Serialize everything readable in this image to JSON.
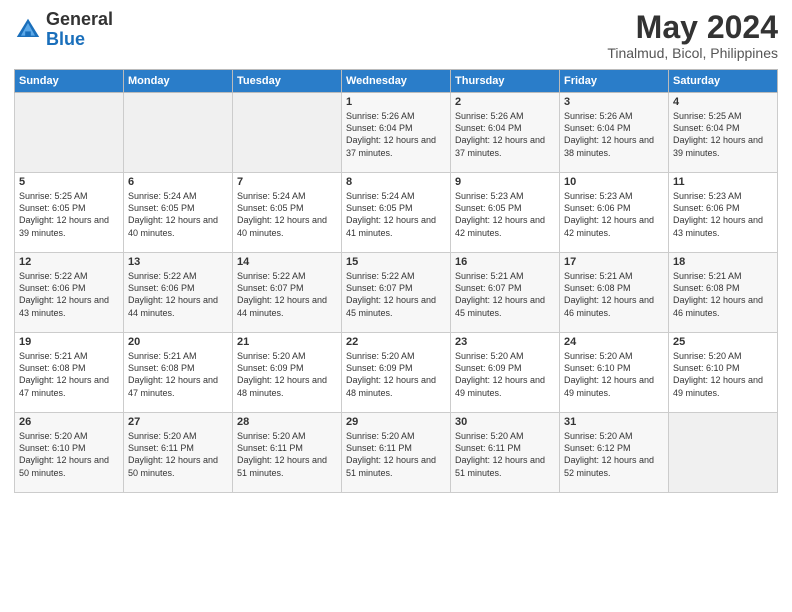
{
  "logo": {
    "general": "General",
    "blue": "Blue"
  },
  "header": {
    "title": "May 2024",
    "subtitle": "Tinalmud, Bicol, Philippines"
  },
  "weekdays": [
    "Sunday",
    "Monday",
    "Tuesday",
    "Wednesday",
    "Thursday",
    "Friday",
    "Saturday"
  ],
  "weeks": [
    [
      {
        "day": "",
        "sunrise": "",
        "sunset": "",
        "daylight": ""
      },
      {
        "day": "",
        "sunrise": "",
        "sunset": "",
        "daylight": ""
      },
      {
        "day": "",
        "sunrise": "",
        "sunset": "",
        "daylight": ""
      },
      {
        "day": "1",
        "sunrise": "Sunrise: 5:26 AM",
        "sunset": "Sunset: 6:04 PM",
        "daylight": "Daylight: 12 hours and 37 minutes."
      },
      {
        "day": "2",
        "sunrise": "Sunrise: 5:26 AM",
        "sunset": "Sunset: 6:04 PM",
        "daylight": "Daylight: 12 hours and 37 minutes."
      },
      {
        "day": "3",
        "sunrise": "Sunrise: 5:26 AM",
        "sunset": "Sunset: 6:04 PM",
        "daylight": "Daylight: 12 hours and 38 minutes."
      },
      {
        "day": "4",
        "sunrise": "Sunrise: 5:25 AM",
        "sunset": "Sunset: 6:04 PM",
        "daylight": "Daylight: 12 hours and 39 minutes."
      }
    ],
    [
      {
        "day": "5",
        "sunrise": "Sunrise: 5:25 AM",
        "sunset": "Sunset: 6:05 PM",
        "daylight": "Daylight: 12 hours and 39 minutes."
      },
      {
        "day": "6",
        "sunrise": "Sunrise: 5:24 AM",
        "sunset": "Sunset: 6:05 PM",
        "daylight": "Daylight: 12 hours and 40 minutes."
      },
      {
        "day": "7",
        "sunrise": "Sunrise: 5:24 AM",
        "sunset": "Sunset: 6:05 PM",
        "daylight": "Daylight: 12 hours and 40 minutes."
      },
      {
        "day": "8",
        "sunrise": "Sunrise: 5:24 AM",
        "sunset": "Sunset: 6:05 PM",
        "daylight": "Daylight: 12 hours and 41 minutes."
      },
      {
        "day": "9",
        "sunrise": "Sunrise: 5:23 AM",
        "sunset": "Sunset: 6:05 PM",
        "daylight": "Daylight: 12 hours and 42 minutes."
      },
      {
        "day": "10",
        "sunrise": "Sunrise: 5:23 AM",
        "sunset": "Sunset: 6:06 PM",
        "daylight": "Daylight: 12 hours and 42 minutes."
      },
      {
        "day": "11",
        "sunrise": "Sunrise: 5:23 AM",
        "sunset": "Sunset: 6:06 PM",
        "daylight": "Daylight: 12 hours and 43 minutes."
      }
    ],
    [
      {
        "day": "12",
        "sunrise": "Sunrise: 5:22 AM",
        "sunset": "Sunset: 6:06 PM",
        "daylight": "Daylight: 12 hours and 43 minutes."
      },
      {
        "day": "13",
        "sunrise": "Sunrise: 5:22 AM",
        "sunset": "Sunset: 6:06 PM",
        "daylight": "Daylight: 12 hours and 44 minutes."
      },
      {
        "day": "14",
        "sunrise": "Sunrise: 5:22 AM",
        "sunset": "Sunset: 6:07 PM",
        "daylight": "Daylight: 12 hours and 44 minutes."
      },
      {
        "day": "15",
        "sunrise": "Sunrise: 5:22 AM",
        "sunset": "Sunset: 6:07 PM",
        "daylight": "Daylight: 12 hours and 45 minutes."
      },
      {
        "day": "16",
        "sunrise": "Sunrise: 5:21 AM",
        "sunset": "Sunset: 6:07 PM",
        "daylight": "Daylight: 12 hours and 45 minutes."
      },
      {
        "day": "17",
        "sunrise": "Sunrise: 5:21 AM",
        "sunset": "Sunset: 6:08 PM",
        "daylight": "Daylight: 12 hours and 46 minutes."
      },
      {
        "day": "18",
        "sunrise": "Sunrise: 5:21 AM",
        "sunset": "Sunset: 6:08 PM",
        "daylight": "Daylight: 12 hours and 46 minutes."
      }
    ],
    [
      {
        "day": "19",
        "sunrise": "Sunrise: 5:21 AM",
        "sunset": "Sunset: 6:08 PM",
        "daylight": "Daylight: 12 hours and 47 minutes."
      },
      {
        "day": "20",
        "sunrise": "Sunrise: 5:21 AM",
        "sunset": "Sunset: 6:08 PM",
        "daylight": "Daylight: 12 hours and 47 minutes."
      },
      {
        "day": "21",
        "sunrise": "Sunrise: 5:20 AM",
        "sunset": "Sunset: 6:09 PM",
        "daylight": "Daylight: 12 hours and 48 minutes."
      },
      {
        "day": "22",
        "sunrise": "Sunrise: 5:20 AM",
        "sunset": "Sunset: 6:09 PM",
        "daylight": "Daylight: 12 hours and 48 minutes."
      },
      {
        "day": "23",
        "sunrise": "Sunrise: 5:20 AM",
        "sunset": "Sunset: 6:09 PM",
        "daylight": "Daylight: 12 hours and 49 minutes."
      },
      {
        "day": "24",
        "sunrise": "Sunrise: 5:20 AM",
        "sunset": "Sunset: 6:10 PM",
        "daylight": "Daylight: 12 hours and 49 minutes."
      },
      {
        "day": "25",
        "sunrise": "Sunrise: 5:20 AM",
        "sunset": "Sunset: 6:10 PM",
        "daylight": "Daylight: 12 hours and 49 minutes."
      }
    ],
    [
      {
        "day": "26",
        "sunrise": "Sunrise: 5:20 AM",
        "sunset": "Sunset: 6:10 PM",
        "daylight": "Daylight: 12 hours and 50 minutes."
      },
      {
        "day": "27",
        "sunrise": "Sunrise: 5:20 AM",
        "sunset": "Sunset: 6:11 PM",
        "daylight": "Daylight: 12 hours and 50 minutes."
      },
      {
        "day": "28",
        "sunrise": "Sunrise: 5:20 AM",
        "sunset": "Sunset: 6:11 PM",
        "daylight": "Daylight: 12 hours and 51 minutes."
      },
      {
        "day": "29",
        "sunrise": "Sunrise: 5:20 AM",
        "sunset": "Sunset: 6:11 PM",
        "daylight": "Daylight: 12 hours and 51 minutes."
      },
      {
        "day": "30",
        "sunrise": "Sunrise: 5:20 AM",
        "sunset": "Sunset: 6:11 PM",
        "daylight": "Daylight: 12 hours and 51 minutes."
      },
      {
        "day": "31",
        "sunrise": "Sunrise: 5:20 AM",
        "sunset": "Sunset: 6:12 PM",
        "daylight": "Daylight: 12 hours and 52 minutes."
      },
      {
        "day": "",
        "sunrise": "",
        "sunset": "",
        "daylight": ""
      }
    ]
  ]
}
